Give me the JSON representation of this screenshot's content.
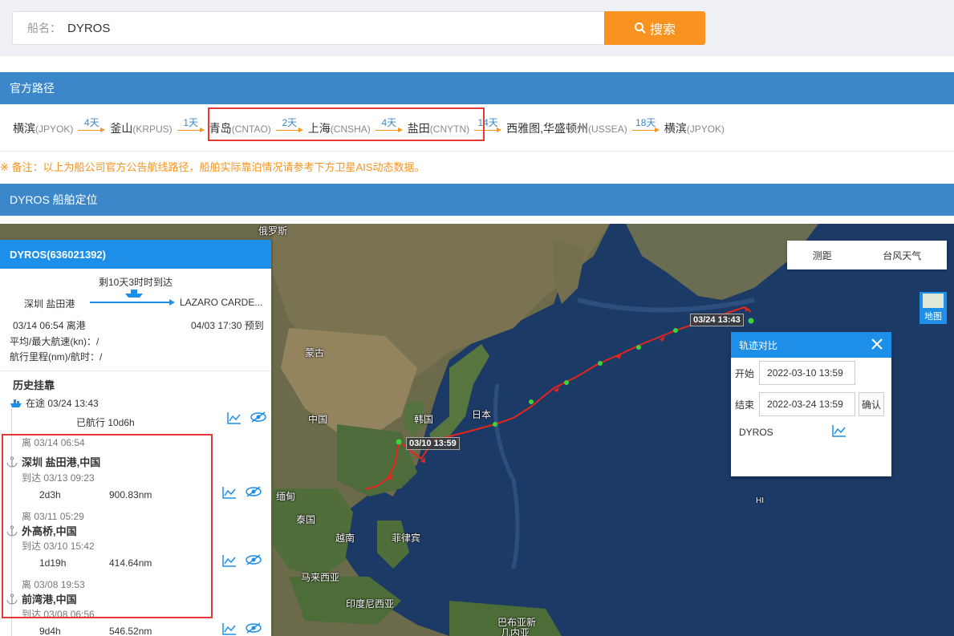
{
  "search": {
    "label": "船名：",
    "value": "DYROS",
    "button": "搜索"
  },
  "official_route": {
    "header": "官方路径",
    "ports": [
      {
        "name": "横滨",
        "code": "(JPYOK)"
      },
      {
        "name": "釜山",
        "code": "(KRPUS)"
      },
      {
        "name": "青岛",
        "code": "(CNTAO)"
      },
      {
        "name": "上海",
        "code": "(CNSHA)"
      },
      {
        "name": "盐田",
        "code": "(CNYTN)"
      },
      {
        "name": "西雅图,华盛顿州",
        "code": "(USSEA)"
      },
      {
        "name": "横滨",
        "code": "(JPYOK)"
      }
    ],
    "legs": [
      "4天",
      "1天",
      "2天",
      "4天",
      "14天",
      "18天"
    ],
    "note": "※ 备注：以上为船公司官方公告航线路径，船舶实际靠泊情况请参考下方卫星AIS动态数据。"
  },
  "positioning": {
    "header": "DYROS 船舶定位"
  },
  "ship_panel": {
    "title": "DYROS(636021392)",
    "eta_text": "剩10天3时时到达",
    "from_port": "深圳 盐田港",
    "to_port": "LAZARO CARDE...",
    "departure": "03/14 06:54 离港",
    "arrival": "04/03 17:30 预到",
    "speed": "平均/最大航速(kn)：/",
    "mileage": "航行里程(nm)/航时：/",
    "history_title": "历史挂靠",
    "current_status": "在途 03/24 13:43",
    "sailed": "已航行 10d6h",
    "stops": [
      {
        "leave": "离 03/14 06:54",
        "name": "深圳 盐田港,中国",
        "arrive": "到达 03/13 09:23",
        "duration": "2d3h",
        "distance": "900.83nm"
      },
      {
        "leave": "离 03/11 05:29",
        "name": "外高桥,中国",
        "arrive": "到达 03/10 15:42",
        "duration": "1d19h",
        "distance": "414.64nm"
      },
      {
        "leave": "离 03/08 19:53",
        "name": "前湾港,中国",
        "arrive": "到达 03/08 06:56",
        "duration": "9d4h",
        "distance": "546.52nm"
      }
    ]
  },
  "map": {
    "tools": [
      "测距",
      "台风天气"
    ],
    "switch_label": "地图",
    "labels": [
      "俄罗斯",
      "蒙古",
      "中国",
      "韩国",
      "日本",
      "缅甸",
      "泰国",
      "越南",
      "菲律宾",
      "马来西亚",
      "印度尼西亚",
      "巴布亚新",
      "几内亚",
      "HI"
    ],
    "tag_start": "03/10 13:59",
    "tag_end": "03/24 13:43"
  },
  "track_compare": {
    "title": "轨迹对比",
    "start_label": "开始",
    "start_value": "2022-03-10 13:59",
    "end_label": "结束",
    "end_value": "2022-03-24 13:59",
    "confirm": "确认",
    "ship": "DYROS"
  },
  "colors": {
    "accent": "#f7931e",
    "header_blue": "#3b87c9",
    "panel_blue": "#1e8fe8",
    "highlight": "#e53935",
    "track": "#e3261b"
  }
}
